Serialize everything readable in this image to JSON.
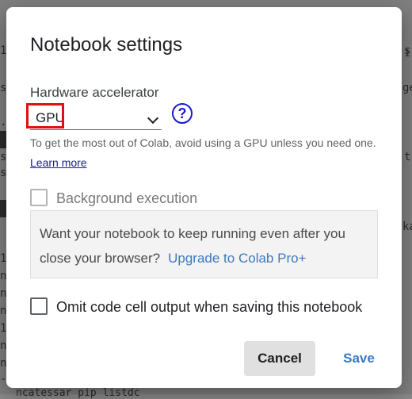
{
  "background": {
    "left_fragments": [
      "1",
      "s",
      ".",
      "s",
      "s",
      "1",
      "n",
      "n",
      "n",
      "1",
      "n",
      "n",
      "-"
    ],
    "right_fragments": [
      "s",
      "1",
      "ge",
      "t",
      "ka",
      "-"
    ],
    "bottom_line": "ncatessar pip listdc"
  },
  "dialog": {
    "title": "Notebook settings",
    "hardware": {
      "label": "Hardware accelerator",
      "value": "GPU",
      "help_glyph": "?"
    },
    "hint": {
      "text": "To get the most out of Colab, avoid using a GPU unless you need one.",
      "link": "Learn more"
    },
    "background_execution": {
      "label": "Background execution",
      "checked": false,
      "disabled": true
    },
    "promo": {
      "text": "Want your notebook to keep running even after you close your browser?",
      "link": "Upgrade to Colab Pro+"
    },
    "omit_output": {
      "label": "Omit code cell output when saving this notebook",
      "checked": false
    },
    "buttons": {
      "cancel": "Cancel",
      "save": "Save"
    }
  },
  "colors": {
    "accent_link": "#3c78c3",
    "highlight_box": "#e01010",
    "help_icon": "#1a1acc"
  }
}
